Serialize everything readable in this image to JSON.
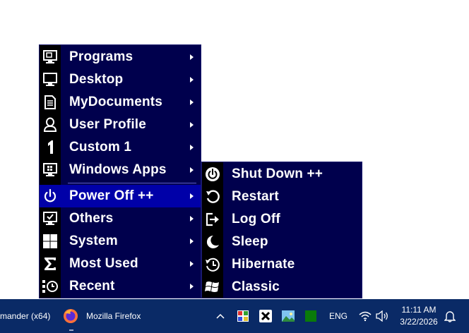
{
  "main_menu": {
    "items": [
      {
        "label": "Programs",
        "icon": "monitor-app-icon",
        "has_arrow": true
      },
      {
        "label": "Desktop",
        "icon": "monitor-icon",
        "has_arrow": true
      },
      {
        "label": "MyDocuments",
        "icon": "document-icon",
        "has_arrow": true
      },
      {
        "label": "User Profile",
        "icon": "user-icon",
        "has_arrow": true
      },
      {
        "label": "Custom 1",
        "icon": "number-one-icon",
        "has_arrow": true
      },
      {
        "label": "Windows Apps",
        "icon": "windows-apps-monitor-icon",
        "has_arrow": true
      },
      {
        "label": "Power Off ++",
        "icon": "power-icon",
        "has_arrow": true,
        "active": true
      },
      {
        "label": "Others",
        "icon": "monitor-check-icon",
        "has_arrow": true
      },
      {
        "label": "System",
        "icon": "windows-logo-icon",
        "has_arrow": true
      },
      {
        "label": "Most Used",
        "icon": "sigma-icon",
        "has_arrow": true
      },
      {
        "label": "Recent",
        "icon": "recent-clock-icon",
        "has_arrow": true
      }
    ]
  },
  "power_submenu": {
    "items": [
      {
        "label": "Shut Down ++",
        "icon": "power-icon"
      },
      {
        "label": "Restart",
        "icon": "restart-icon"
      },
      {
        "label": "Log Off",
        "icon": "log-off-icon"
      },
      {
        "label": "Sleep",
        "icon": "moon-icon"
      },
      {
        "label": "Hibernate",
        "icon": "hibernate-clock-icon"
      },
      {
        "label": "Classic",
        "icon": "windows-flag-icon"
      }
    ]
  },
  "taskbar": {
    "left_app_label": "mander (x64)",
    "firefox_label": "Mozilla Firefox",
    "language": "ENG",
    "time": "11:11 AM",
    "date": "3/22/2026"
  },
  "colors": {
    "menu_bg": "#00004d",
    "icon_column": "#000000",
    "active_item": "#0000a8",
    "taskbar_bg": "#0a2a66"
  }
}
